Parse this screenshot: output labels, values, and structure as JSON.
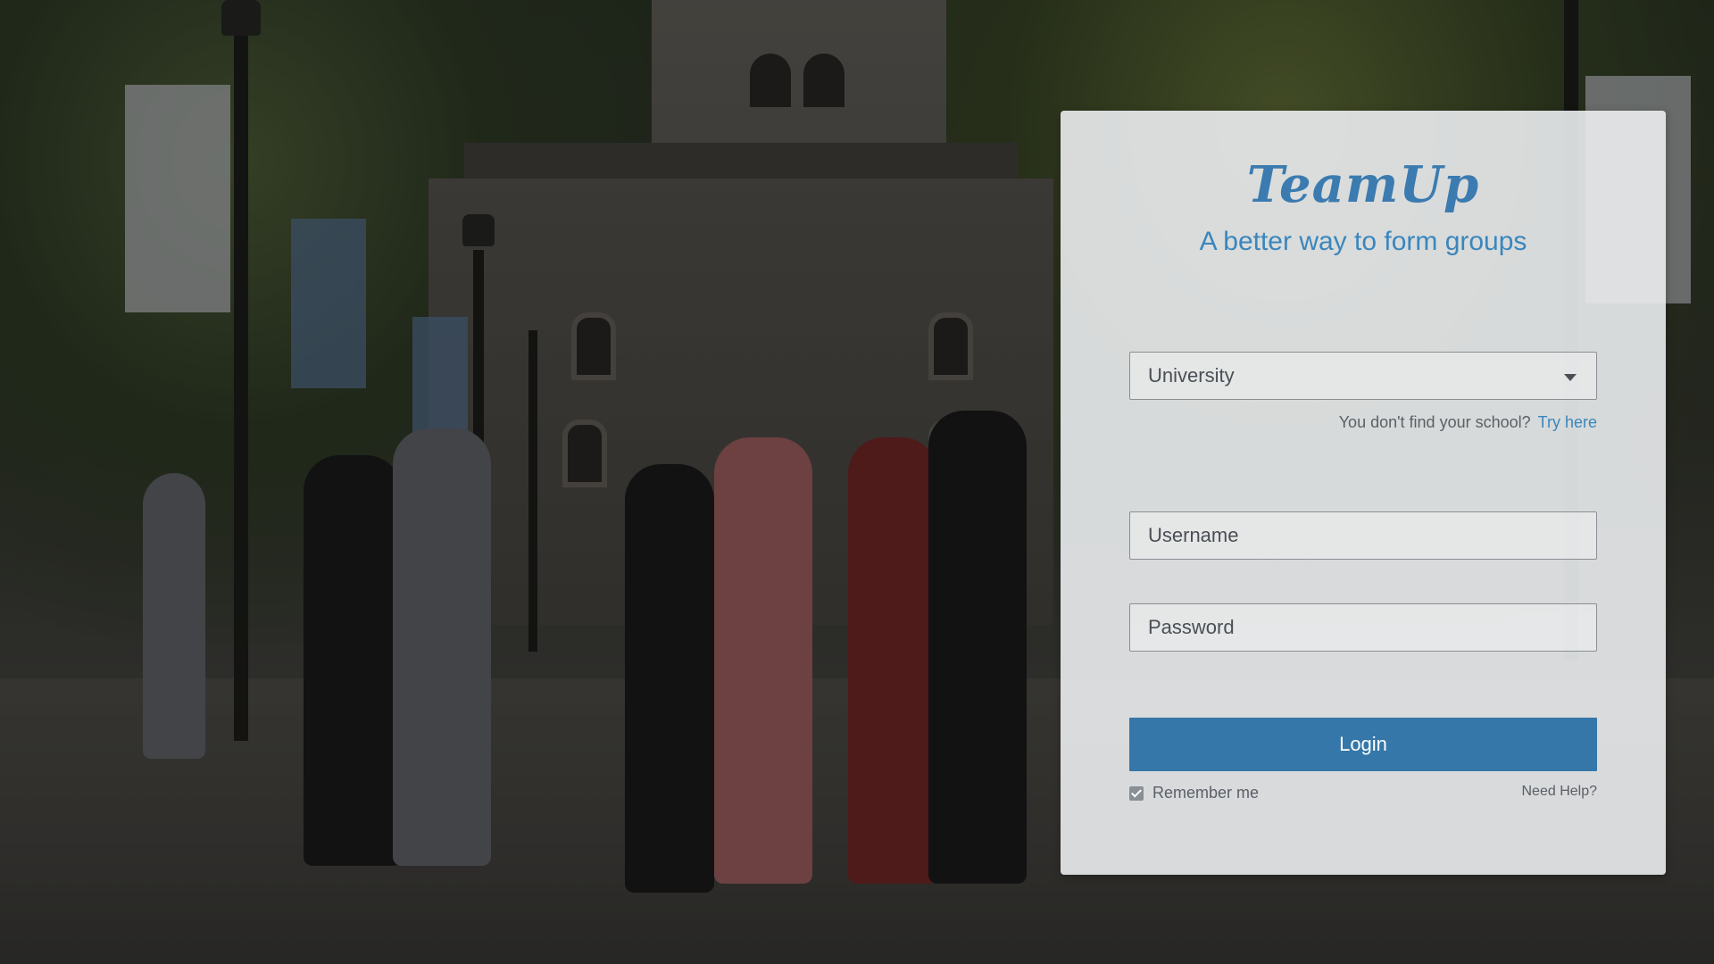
{
  "brand": {
    "name": "TeamUp",
    "tagline": "A better way to form groups"
  },
  "login_form": {
    "university_select": {
      "value": "University"
    },
    "school_hint": {
      "text": "You don't find your school?",
      "link_label": "Try here"
    },
    "username": {
      "placeholder": "Username",
      "value": ""
    },
    "password": {
      "placeholder": "Password",
      "value": ""
    },
    "login_label": "Login",
    "remember_me": {
      "label": "Remember me",
      "checked": true
    },
    "help_link": "Need Help?"
  },
  "colors": {
    "accent": "#3577a8",
    "brand_text": "#3b7bb0",
    "card_background": "#ebedf0"
  }
}
